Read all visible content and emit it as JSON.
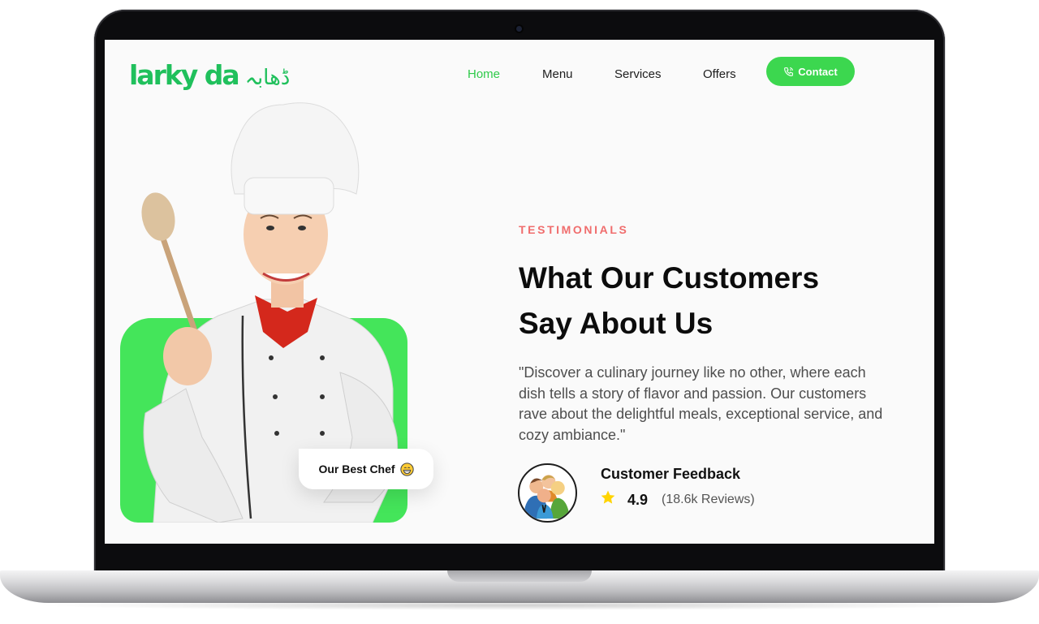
{
  "brand": {
    "name": "larky da",
    "urdu": "ڈھابہ",
    "color": "#20c05c"
  },
  "nav": {
    "items": [
      {
        "label": "Home",
        "active": true
      },
      {
        "label": "Menu",
        "active": false
      },
      {
        "label": "Services",
        "active": false
      },
      {
        "label": "Offers",
        "active": false
      }
    ],
    "contact_label": "Contact",
    "contact_icon": "phone-icon"
  },
  "hero": {
    "image": "chef-photo",
    "badge_label": "Our Best Chef",
    "badge_icon": "grin-emoji-icon"
  },
  "testimonials": {
    "eyebrow": "TESTIMONIALS",
    "headline_line1": "What Our Customers",
    "headline_line2": "Say About Us",
    "quote": "\"Discover a culinary journey like no other, where each dish tells a story of flavor and passion. Our customers rave about the delightful meals, exceptional service, and cozy ambiance.\"",
    "feedback": {
      "title": "Customer Feedback",
      "rating": "4.9",
      "reviews": "(18.6k Reviews)",
      "avatar_icon": "customers-group-icon",
      "star_icon": "star-icon"
    }
  },
  "colors": {
    "accent_green": "#3cd74f",
    "nav_active": "#2fca4a",
    "eyebrow": "#f06d6d",
    "star": "#ffd400"
  }
}
